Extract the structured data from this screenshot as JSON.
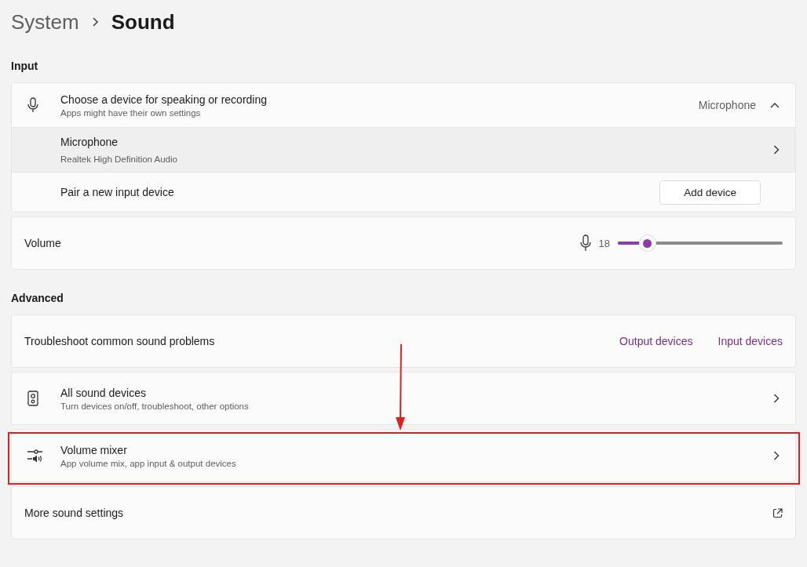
{
  "breadcrumb": {
    "parent": "System",
    "current": "Sound"
  },
  "sections": [
    {
      "heading": "Input",
      "cards": [
        {
          "rows": [
            {
              "kind": "expander",
              "title": "Choose a device for speaking or recording",
              "subtitle": "Apps might have their own settings",
              "value": "Microphone",
              "expanded": true
            },
            {
              "kind": "device",
              "title": "Microphone",
              "subtitle": "Realtek High Definition Audio",
              "highlighted": true
            },
            {
              "kind": "action",
              "title": "Pair a new input device",
              "button": "Add device"
            }
          ]
        },
        {
          "rows": [
            {
              "kind": "volume",
              "title": "Volume",
              "reading": "18",
              "level": 0.18
            }
          ]
        }
      ]
    },
    {
      "heading": "Advanced",
      "cards": [
        {
          "rows": [
            {
              "kind": "links",
              "title": "Troubleshoot common sound problems",
              "links": [
                "Output devices",
                "Input devices"
              ]
            }
          ]
        },
        {
          "rows": [
            {
              "kind": "devices",
              "title": "All sound devices",
              "subtitle": "Turn devices on/off, troubleshoot, other options"
            }
          ]
        },
        {
          "annotated": true,
          "rows": [
            {
              "kind": "mixer",
              "title": "Volume mixer",
              "subtitle": "App volume mix, app input & output devices"
            }
          ]
        },
        {
          "rows": [
            {
              "kind": "external",
              "title": "More sound settings"
            }
          ]
        }
      ]
    }
  ]
}
